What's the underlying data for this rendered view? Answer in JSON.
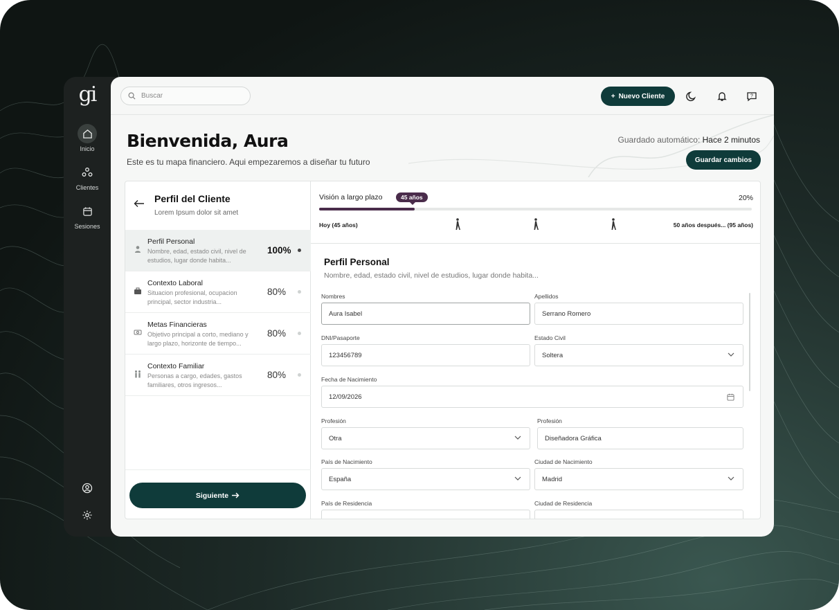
{
  "rail": {
    "logo": "gi",
    "items": [
      {
        "label": "Inicio",
        "icon": "home-icon"
      },
      {
        "label": "Clientes",
        "icon": "clients-icon"
      },
      {
        "label": "Sesiones",
        "icon": "calendar-icon"
      }
    ]
  },
  "topbar": {
    "search_placeholder": "Buscar",
    "new_client": "Nuevo Cliente"
  },
  "header": {
    "title": "Bienvenida, Aura",
    "subtitle": "Este es tu mapa financiero. Aqui empezaremos a diseñar tu futuro",
    "saved_label": "Guardado automático:",
    "saved_value": "Hace 2 minutos",
    "save_button": "Guardar cambios"
  },
  "profile_panel": {
    "title": "Perfil del Cliente",
    "subtitle": "Lorem Ipsum dolor sit amet",
    "sections": [
      {
        "title": "Perfil Personal",
        "desc": "Nombre, edad, estado civil, nivel de estudios, lugar donde habita...",
        "percent": "100%",
        "icon": "person-icon"
      },
      {
        "title": "Contexto Laboral",
        "desc": "Situacion profesional, ocupacion principal, sector industria...",
        "percent": "80%",
        "icon": "briefcase-icon"
      },
      {
        "title": "Metas Financieras",
        "desc": "Objetivo principal a corto, mediano y largo plazo, horizonte de tiempo...",
        "percent": "80%",
        "icon": "money-icon"
      },
      {
        "title": "Contexto Familiar",
        "desc": "Personas a cargo, edades, gastos familiares, otros ingresos...",
        "percent": "80%",
        "icon": "family-icon"
      }
    ],
    "next_button": "Siguiente"
  },
  "vision": {
    "label": "Visión a largo plazo",
    "badge": "45 años",
    "percent": "20%",
    "progress": 0.22,
    "start": "Hoy (45 años)",
    "end": "50 años después... (95 años)"
  },
  "form": {
    "title": "Perfil Personal",
    "subtitle": "Nombre, edad, estado civil, nivel de estudios, lugar donde habita...",
    "fields": {
      "nombres": {
        "label": "Nombres",
        "value": "Aura Isabel"
      },
      "apellidos": {
        "label": "Apellidos",
        "value": "Serrano Romero"
      },
      "dni": {
        "label": "DNI/Pasaporte",
        "value": "123456789"
      },
      "estado_civil": {
        "label": "Estado Civil",
        "value": "Soltera"
      },
      "fecha": {
        "label": "Fecha de Nacimiento",
        "value": "12/09/2026"
      },
      "profesion_tipo": {
        "label": "Profesión",
        "value": "Otra"
      },
      "profesion": {
        "label": "Profesión",
        "value": "Diseñadora Gráfica"
      },
      "pais_nac": {
        "label": "País de Nacimiento",
        "value": "España"
      },
      "ciudad_nac": {
        "label": "Ciudad de Nacimiento",
        "value": "Madrid"
      },
      "pais_res": {
        "label": "País de Residencia",
        "value": ""
      },
      "ciudad_res": {
        "label": "Ciudad de Residencia",
        "value": ""
      }
    }
  },
  "colors": {
    "primary": "#0f3b3a",
    "accent": "#4a2c4b",
    "rail": "#1d2120"
  }
}
